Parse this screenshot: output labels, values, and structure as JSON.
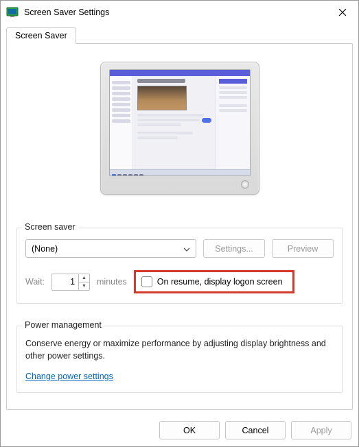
{
  "window": {
    "title": "Screen Saver Settings"
  },
  "tab": {
    "label": "Screen Saver"
  },
  "screensaver": {
    "group_label": "Screen saver",
    "dropdown_value": "(None)",
    "settings_btn": "Settings...",
    "preview_btn": "Preview",
    "wait_label": "Wait:",
    "wait_value": "1",
    "wait_unit": "minutes",
    "resume_label": "On resume, display logon screen"
  },
  "power": {
    "group_label": "Power management",
    "text": "Conserve energy or maximize performance by adjusting display brightness and other power settings.",
    "link": "Change power settings"
  },
  "buttons": {
    "ok": "OK",
    "cancel": "Cancel",
    "apply": "Apply"
  }
}
